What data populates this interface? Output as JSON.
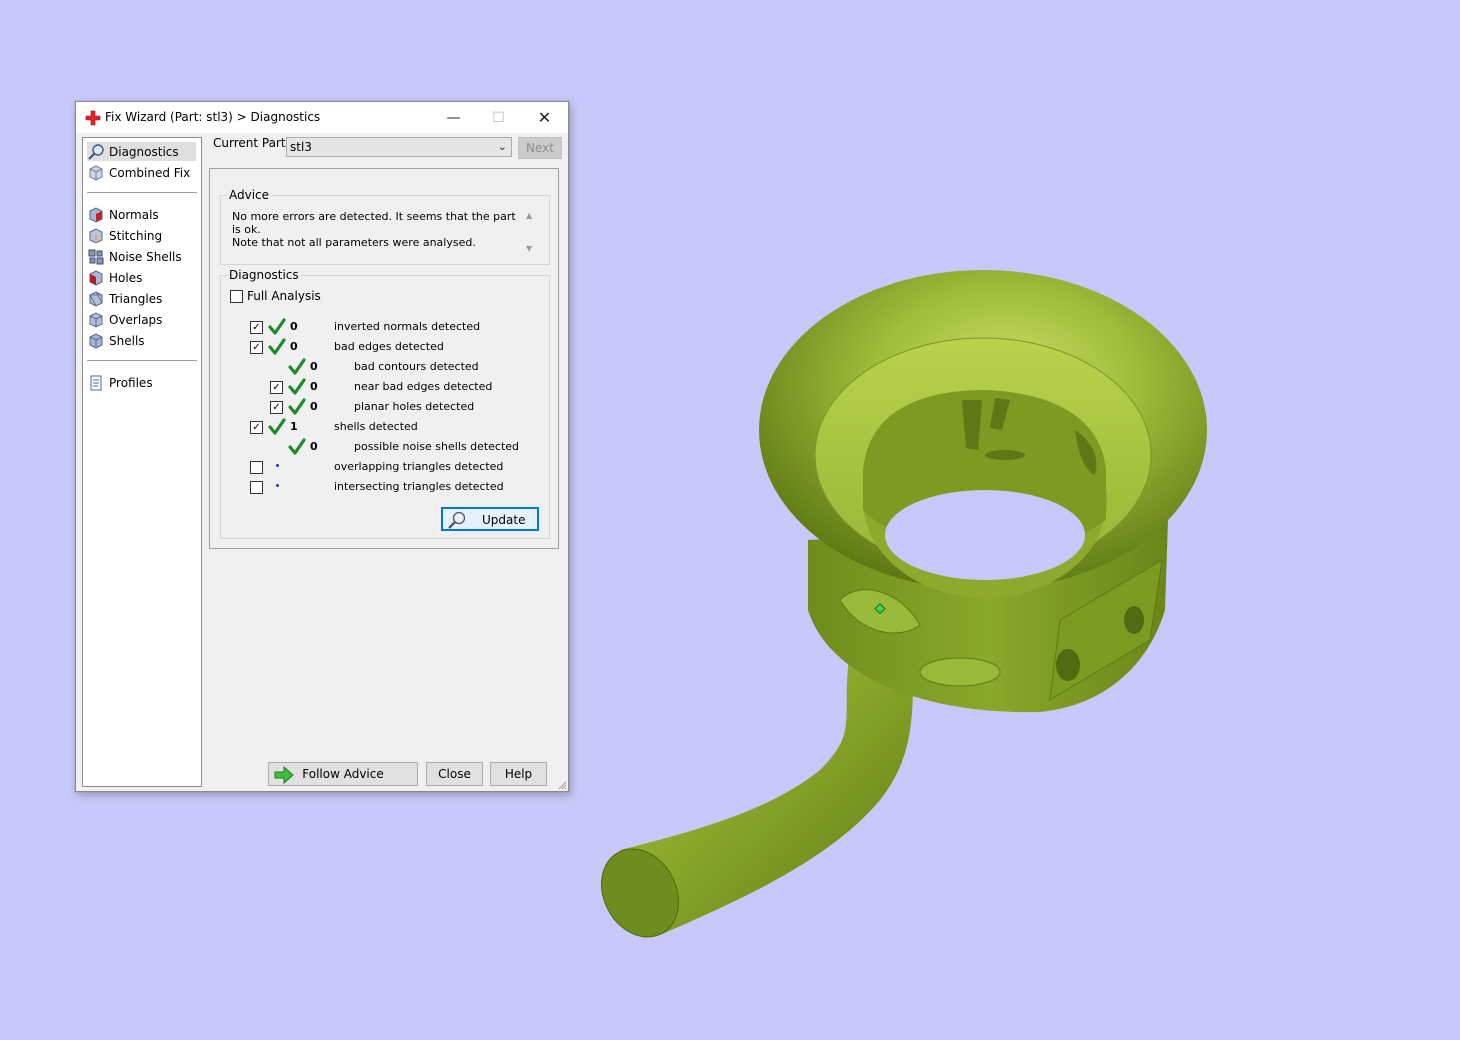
{
  "dialog": {
    "title": "Fix Wizard (Part: stl3) > Diagnostics",
    "controls": {
      "minimize": "—",
      "maximize": "☐",
      "close": "✕"
    }
  },
  "nav": {
    "items": [
      {
        "label": "Diagnostics",
        "icon": "magnifier-icon",
        "selected": true
      },
      {
        "label": "Combined Fix",
        "icon": "cube-icon"
      },
      {
        "label": "Normals",
        "icon": "normals-cube-icon"
      },
      {
        "label": "Stitching",
        "icon": "stitching-cube-icon"
      },
      {
        "label": "Noise Shells",
        "icon": "noise-shells-icon"
      },
      {
        "label": "Holes",
        "icon": "holes-cube-icon"
      },
      {
        "label": "Triangles",
        "icon": "triangles-cube-icon"
      },
      {
        "label": "Overlaps",
        "icon": "overlaps-cube-icon"
      },
      {
        "label": "Shells",
        "icon": "shells-cube-icon"
      },
      {
        "label": "Profiles",
        "icon": "document-icon"
      }
    ]
  },
  "current_part": {
    "label": "Current Part:",
    "value": "stl3",
    "next_label": "Next"
  },
  "advice": {
    "title": "Advice",
    "text": "No more errors are detected. It seems that the part is ok.\nNote that not all parameters were analysed."
  },
  "diagnostics": {
    "title": "Diagnostics",
    "full_analysis_label": "Full Analysis",
    "full_analysis_checked": false,
    "rows": [
      {
        "checkbox": true,
        "checked": true,
        "status": "ok",
        "count": "0",
        "label": "inverted normals detected",
        "indent": 0
      },
      {
        "checkbox": true,
        "checked": true,
        "status": "ok",
        "count": "0",
        "label": "bad edges detected",
        "indent": 0
      },
      {
        "checkbox": false,
        "checked": false,
        "status": "ok",
        "count": "0",
        "label": "bad contours detected",
        "indent": 1
      },
      {
        "checkbox": true,
        "checked": true,
        "status": "ok",
        "count": "0",
        "label": "near bad edges detected",
        "indent": 1
      },
      {
        "checkbox": true,
        "checked": true,
        "status": "ok",
        "count": "0",
        "label": "planar holes detected",
        "indent": 1
      },
      {
        "checkbox": true,
        "checked": true,
        "status": "ok",
        "count": "1",
        "label": "shells detected",
        "indent": 0
      },
      {
        "checkbox": false,
        "checked": false,
        "status": "ok",
        "count": "0",
        "label": "possible noise shells detected",
        "indent": 1
      },
      {
        "checkbox": true,
        "checked": false,
        "status": "pending",
        "count": "",
        "label": "overlapping triangles detected",
        "indent": 0
      },
      {
        "checkbox": true,
        "checked": false,
        "status": "pending",
        "count": "",
        "label": "intersecting triangles detected",
        "indent": 0
      }
    ],
    "update_label": "Update"
  },
  "buttons": {
    "follow_advice": "Follow Advice",
    "close": "Close",
    "help": "Help"
  },
  "colors": {
    "background": "#c8c8fa",
    "model_green": "#8aa82a",
    "check_green": "#1f8a2a",
    "accent_blue": "#0078d7"
  }
}
